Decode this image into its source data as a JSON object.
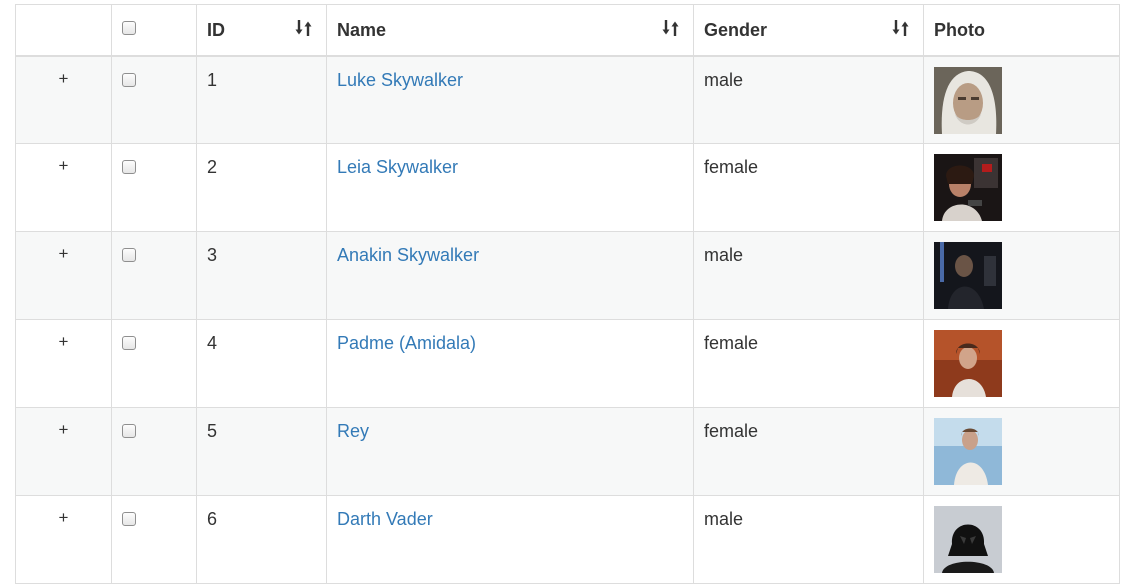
{
  "table": {
    "headers": {
      "expand": "",
      "select_all": "",
      "id": "ID",
      "name": "Name",
      "gender": "Gender",
      "photo": "Photo"
    },
    "rows": [
      {
        "expand": "+",
        "id": "1",
        "name": "Luke Skywalker",
        "gender": "male",
        "photo": "luke-photo"
      },
      {
        "expand": "+",
        "id": "2",
        "name": "Leia Skywalker",
        "gender": "female",
        "photo": "leia-photo"
      },
      {
        "expand": "+",
        "id": "3",
        "name": "Anakin Skywalker",
        "gender": "male",
        "photo": "anakin-photo"
      },
      {
        "expand": "+",
        "id": "4",
        "name": "Padme (Amidala)",
        "gender": "female",
        "photo": "padme-photo"
      },
      {
        "expand": "+",
        "id": "5",
        "name": "Rey",
        "gender": "female",
        "photo": "rey-photo"
      },
      {
        "expand": "+",
        "id": "6",
        "name": "Darth Vader",
        "gender": "male",
        "photo": "vader-photo"
      }
    ]
  },
  "colors": {
    "link": "#337ab7",
    "stripe": "#f7f8f8",
    "border": "#dddddd"
  }
}
